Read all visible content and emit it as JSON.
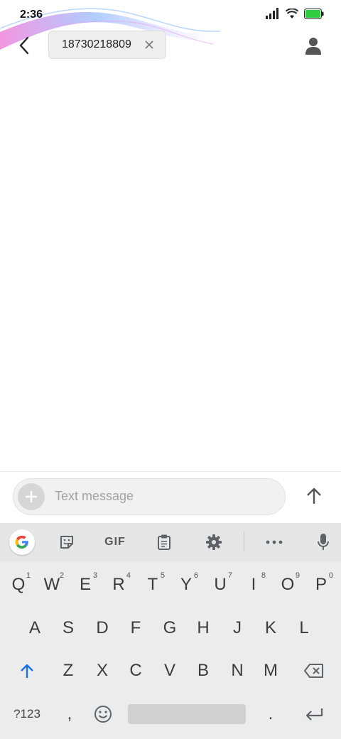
{
  "status_bar": {
    "time": "2:36",
    "icons": [
      "signal-icon",
      "wifi-icon",
      "battery-icon"
    ],
    "battery_color": "#2ecc40"
  },
  "header": {
    "back_icon": "back-arrow-icon",
    "recipient": "18730218809",
    "chip_close_icon": "close-icon",
    "contact_icon": "person-icon"
  },
  "compose": {
    "add_icon": "plus-icon",
    "placeholder": "Text message",
    "send_icon": "arrow-up-icon"
  },
  "keyboard": {
    "toolbar": {
      "items": [
        "google-icon",
        "sticker-icon",
        "gif",
        "clipboard-icon",
        "gear-icon",
        "more-icon",
        "mic-icon"
      ],
      "gif_label": "GIF"
    },
    "row1": [
      {
        "k": "Q",
        "h": "1"
      },
      {
        "k": "W",
        "h": "2"
      },
      {
        "k": "E",
        "h": "3"
      },
      {
        "k": "R",
        "h": "4"
      },
      {
        "k": "T",
        "h": "5"
      },
      {
        "k": "Y",
        "h": "6"
      },
      {
        "k": "U",
        "h": "7"
      },
      {
        "k": "I",
        "h": "8"
      },
      {
        "k": "O",
        "h": "9"
      },
      {
        "k": "P",
        "h": "0"
      }
    ],
    "row2": [
      "A",
      "S",
      "D",
      "F",
      "G",
      "H",
      "J",
      "K",
      "L"
    ],
    "row3": [
      "Z",
      "X",
      "C",
      "V",
      "B",
      "N",
      "M"
    ],
    "row4": {
      "symbols": "?123",
      "comma": ",",
      "period": "."
    },
    "accent": "#1a73e8"
  }
}
